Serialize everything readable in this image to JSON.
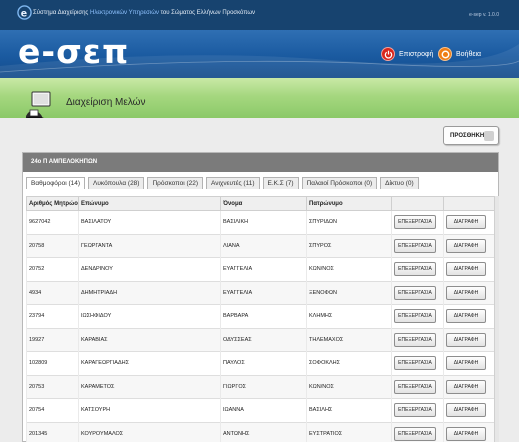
{
  "topbar": {
    "system_prefix": "Σύστημα Διαχείρισης",
    "system_highlight": "Ηλεκτρονικών Υπηρεσιών",
    "system_suffix": "του Σώματος Ελλήνων Προσκόπων",
    "version": "e-sep v. 1.0.0"
  },
  "banner": {
    "brand": "e-σεπ",
    "back_label": "Επιστροφή",
    "help_label": "Βοήθεια"
  },
  "page": {
    "title": "Διαχείριση Μελών"
  },
  "toolbar": {
    "add_label": "ΠΡΟΣΘΗΚΗ"
  },
  "panel": {
    "title": "24ο Π ΑΜΠΕΛΟΚΗΠΩΝ"
  },
  "tabs": [
    {
      "label": "Βαθμοφόροι (14)"
    },
    {
      "label": "Λυκόπουλα (28)"
    },
    {
      "label": "Πρόσκοποι (22)"
    },
    {
      "label": "Ανιχνευτές (11)"
    },
    {
      "label": "Ε.Κ.Σ (7)"
    },
    {
      "label": "Παλαιοί Πρόσκοποι (0)"
    },
    {
      "label": "Δίκτυο (0)"
    }
  ],
  "table": {
    "columns": [
      "Αριθμός Μητρώου",
      "Επώνυμο",
      "Όνομα",
      "Πατρώνυμο"
    ],
    "edit_label": "ΕΠΕΞΕΡΓΑΣΙΑ",
    "delete_label": "ΔΙΑΓΡΑΦΗ",
    "rows": [
      {
        "id": "9627042",
        "surname": "ΒΑΣΙΛΑΤΟΥ",
        "name": "ΒΑΣΙΛΙΚΗ",
        "father": "ΣΠΥΡΙΔΩΝ"
      },
      {
        "id": "20758",
        "surname": "ΓΕΩΡΓΑΝΤΑ",
        "name": "ΛΙΑΝΑ",
        "father": "ΣΠΥΡΟΣ"
      },
      {
        "id": "20752",
        "surname": "ΔΕΝΔΡΙΝΟΥ",
        "name": "ΕΥΑΓΓΕΛΙΑ",
        "father": "ΚΩΝ/ΝΟΣ"
      },
      {
        "id": "4934",
        "surname": "ΔΗΜΗΤΡΙΑΔΗ",
        "name": "ΕΥΑΓΓΕΛΙΑ",
        "father": "ΞΕΝΟΦΩΝ"
      },
      {
        "id": "23794",
        "surname": "ΙΩΣΗΦΙΔΟΥ",
        "name": "ΒΑΡΒΑΡΑ",
        "father": "ΚΛΗΜΗΣ"
      },
      {
        "id": "19927",
        "surname": "ΚΑΡΑΒΙΑΣ",
        "name": "ΟΔΥΣΣΕΑΣ",
        "father": "ΤΗΛΕΜΑΧΟΣ"
      },
      {
        "id": "102809",
        "surname": "ΚΑΡΑΓΕΩΡΓΙΑΔΗΣ",
        "name": "ΠΑΥΛΟΣ",
        "father": "ΣΟΦΟΚΛΗΣ"
      },
      {
        "id": "20753",
        "surname": "ΚΑΡΑΜΕΤΟΣ",
        "name": "ΓΙΩΡΓΟΣ",
        "father": "ΚΩΝ/ΝΟΣ"
      },
      {
        "id": "20754",
        "surname": "ΚΑΤΣΟΥΡΗ",
        "name": "ΙΩΑΝΝΑ",
        "father": "ΒΑΣΙΛΗΣ"
      },
      {
        "id": "201345",
        "surname": "ΚΟΥΡΟΥΜΑΛΟΣ",
        "name": "ΑΝΤΩΝΗΣ",
        "father": "ΕΥΣΤΡΑΤΙΟΣ"
      }
    ]
  },
  "colors": {
    "topbar": "#17436f",
    "banner": "#1a5aa0",
    "titlebar": "#a5d77f",
    "panel_header": "#7b7b7b"
  },
  "icons": {
    "logo": "e-logo-icon",
    "back": "power-icon",
    "help": "lifebuoy-icon",
    "page": "members-icon",
    "add": "add-member-icon"
  }
}
